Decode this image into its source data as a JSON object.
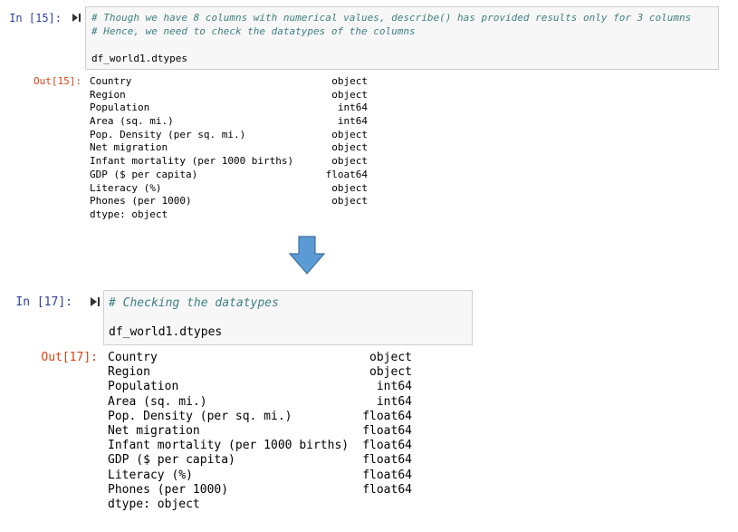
{
  "cell1": {
    "in_prompt": "In [15]:",
    "comment_lines": [
      "# Though we have 8 columns with numerical values, describe() has provided results only for 3 columns",
      "# Hence, we need to check the datatypes of the columns"
    ],
    "code": "df_world1.dtypes",
    "out_prompt": "Out[15]:",
    "rows": [
      {
        "name": "Country",
        "dtype": "object"
      },
      {
        "name": "Region",
        "dtype": "object"
      },
      {
        "name": "Population",
        "dtype": "int64"
      },
      {
        "name": "Area (sq. mi.)",
        "dtype": "int64"
      },
      {
        "name": "Pop. Density (per sq. mi.)",
        "dtype": "object"
      },
      {
        "name": "Net migration",
        "dtype": "object"
      },
      {
        "name": "Infant mortality (per 1000 births)",
        "dtype": "object"
      },
      {
        "name": "GDP ($ per capita)",
        "dtype": "float64"
      },
      {
        "name": "Literacy (%)",
        "dtype": "object"
      },
      {
        "name": "Phones (per 1000)",
        "dtype": "object"
      }
    ],
    "footer": "dtype: object"
  },
  "cell2": {
    "in_prompt": "In [17]:",
    "comment": "# Checking the datatypes",
    "code": "df_world1.dtypes",
    "out_prompt": "Out[17]:",
    "rows": [
      {
        "name": "Country",
        "dtype": "object"
      },
      {
        "name": "Region",
        "dtype": "object"
      },
      {
        "name": "Population",
        "dtype": "int64"
      },
      {
        "name": "Area (sq. mi.)",
        "dtype": "int64"
      },
      {
        "name": "Pop. Density (per sq. mi.)",
        "dtype": "float64"
      },
      {
        "name": "Net migration",
        "dtype": "float64"
      },
      {
        "name": "Infant mortality (per 1000 births)",
        "dtype": "float64"
      },
      {
        "name": "GDP ($ per capita)",
        "dtype": "float64"
      },
      {
        "name": "Literacy (%)",
        "dtype": "float64"
      },
      {
        "name": "Phones (per 1000)",
        "dtype": "float64"
      }
    ],
    "footer": "dtype: object"
  },
  "colors": {
    "in_prompt": "#303f9f",
    "out_prompt": "#d84315",
    "comment": "#408080",
    "input_bg": "#f7f7f7",
    "input_border": "#cfcfcf",
    "arrow": "#5b9bd5"
  },
  "icons": {
    "run": "skip-to-end-icon",
    "arrow": "down-arrow-icon"
  }
}
